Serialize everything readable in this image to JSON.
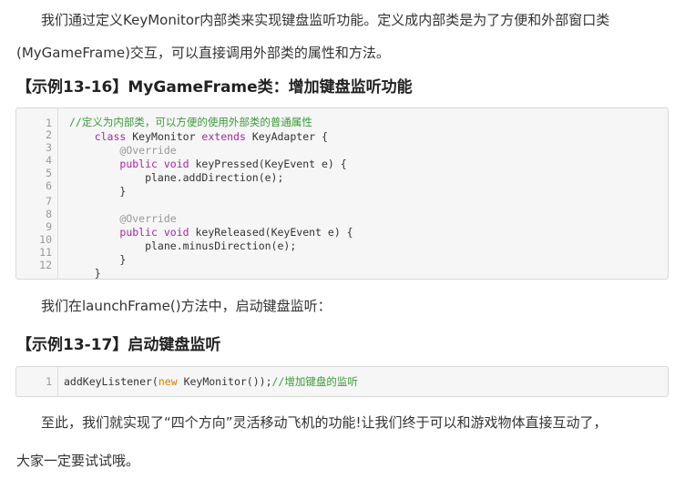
{
  "intro": {
    "line1": "我们通过定义KeyMonitor内部类来实现键盘监听功能。定义成内部类是为了方便和外部窗口类",
    "line2": "(MyGameFrame)交互，可以直接调用外部类的属性和方法。"
  },
  "example1": {
    "heading": "【示例13-16】MyGameFrame类：增加键盘监听功能",
    "line_numbers": [
      "1",
      "2",
      "3",
      "4",
      "5",
      "6",
      "7",
      "8",
      "9",
      "10",
      "11",
      "12"
    ],
    "lines": {
      "l1_comment": "//定义为内部类，可以方便的使用外部类的普通属性",
      "l2_indent": "    ",
      "l2_kw1": "class",
      "l2_name": " KeyMonitor ",
      "l2_kw2": "extends",
      "l2_rest": " KeyAdapter {",
      "l3_indent": "        ",
      "l3_ann": "@Override",
      "l4_indent": "        ",
      "l4_kw1": "public",
      "l4_sp": " ",
      "l4_kw2": "void",
      "l4_rest": " keyPressed(KeyEvent e) {",
      "l5": "            plane.addDirection(e);",
      "l6": "        }",
      "l8_indent": "        ",
      "l8_ann": "@Override",
      "l9_indent": "        ",
      "l9_kw1": "public",
      "l9_sp": " ",
      "l9_kw2": "void",
      "l9_rest": " keyReleased(KeyEvent e) {",
      "l10": "            plane.minusDirection(e);",
      "l11": "        }",
      "l12": "    }"
    }
  },
  "middle_text": "我们在launchFrame()方法中，启动键盘监听：",
  "example2": {
    "heading": "【示例13-17】启动键盘监听",
    "line_number": "1",
    "code_pre": "addKeyListener(",
    "code_kw": "new",
    "code_post": " KeyMonitor());",
    "code_comment": "//增加键盘的监听"
  },
  "outro": {
    "line1": "至此，我们就实现了“四个方向”灵活移动飞机的功能!让我们终于可以和游戏物体直接互动了，",
    "line2": "大家一定要试试哦。"
  },
  "colors": {
    "keyword": "#a626a4",
    "comment": "#3a9a3a",
    "annotation": "#999999",
    "literal_new": "#e07b00",
    "code_background": "#f6f6f6"
  }
}
